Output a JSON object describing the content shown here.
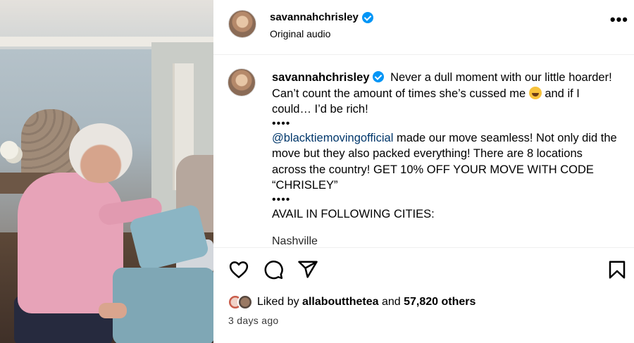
{
  "post": {
    "username": "savannahchrisley",
    "audio": "Original audio",
    "more_glyph": "•••"
  },
  "caption": {
    "username": "savannahchrisley",
    "line1": "Never a dull moment with our little hoarder! Can’t count the amount of times she’s cussed me",
    "line1b": "and if I could… I’d be rich!",
    "dots1": "••••",
    "mention": "@blacktiemovingofficial",
    "promo": "made our move seamless! Not only did the move but they also packed everything! There are 8 locations across the country! GET 10% OFF YOUR MOVE WITH CODE “CHRISLEY”",
    "dots2": "••••",
    "avail": "AVAIL IN FOLLOWING CITIES:",
    "cutoff": "Nashville"
  },
  "likes": {
    "prefix": "Liked by",
    "user": "allaboutthetea",
    "mid": "and",
    "count": "57,820 others"
  },
  "time": "3 days ago",
  "icons": [
    "heart-icon",
    "comment-icon",
    "share-icon",
    "bookmark-icon",
    "verified-icon",
    "emoji-laughing-icon"
  ],
  "colors": {
    "verified": "#0095f6",
    "link": "#00376b"
  }
}
